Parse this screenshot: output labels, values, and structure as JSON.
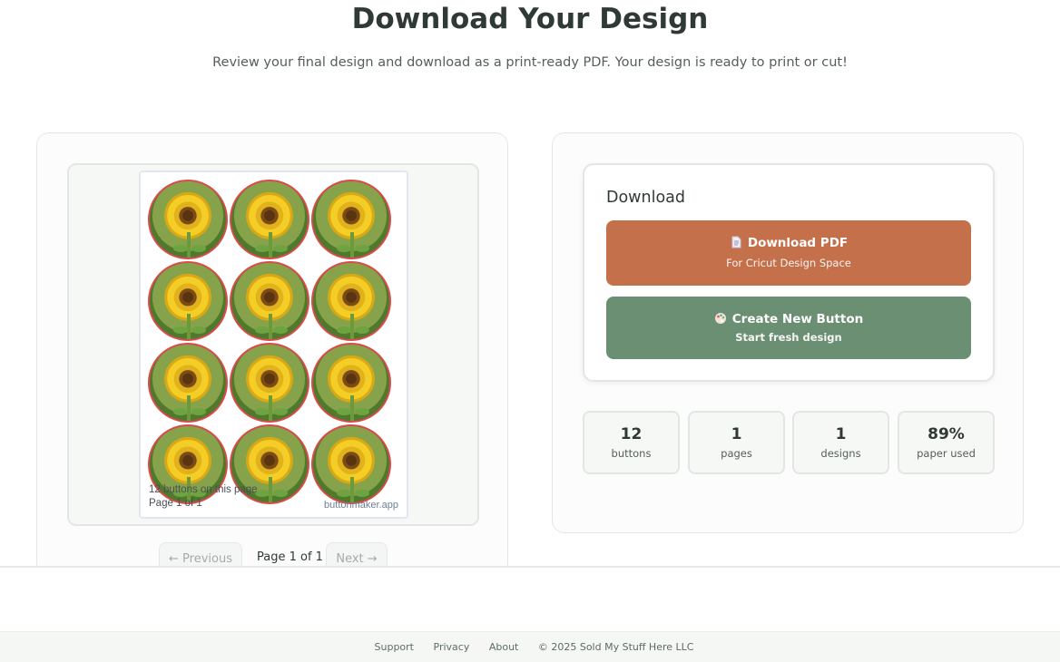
{
  "header": {
    "title": "Download Your Design",
    "subtitle": "Review your final design and download as a print-ready PDF. Your design is ready to print or cut!"
  },
  "preview": {
    "sheet_meta_line1": "12 buttons on this page",
    "sheet_meta_line2": "Page 1 of 1",
    "brand": "buttonmaker.app",
    "button_image": "sunflower"
  },
  "pager": {
    "prev_label": "← Previous",
    "info": "Page 1 of 1",
    "next_label": "Next →"
  },
  "download": {
    "title": "Download",
    "pdf_label": "Download PDF",
    "pdf_sub": "For Cricut Design Space",
    "pdf_icon": "document-icon",
    "new_label": "Create New Button",
    "new_sub": "Start fresh design",
    "new_icon": "palette-icon",
    "pdf_color": "#c4704b",
    "new_color": "#6b8f72"
  },
  "stats": [
    {
      "value": "12",
      "label": "buttons"
    },
    {
      "value": "1",
      "label": "pages"
    },
    {
      "value": "1",
      "label": "designs"
    },
    {
      "value": "89%",
      "label": "paper used"
    }
  ],
  "footer": {
    "links": [
      "Support",
      "Privacy",
      "About"
    ],
    "copyright": "© 2025 Sold My Stuff Here LLC"
  }
}
